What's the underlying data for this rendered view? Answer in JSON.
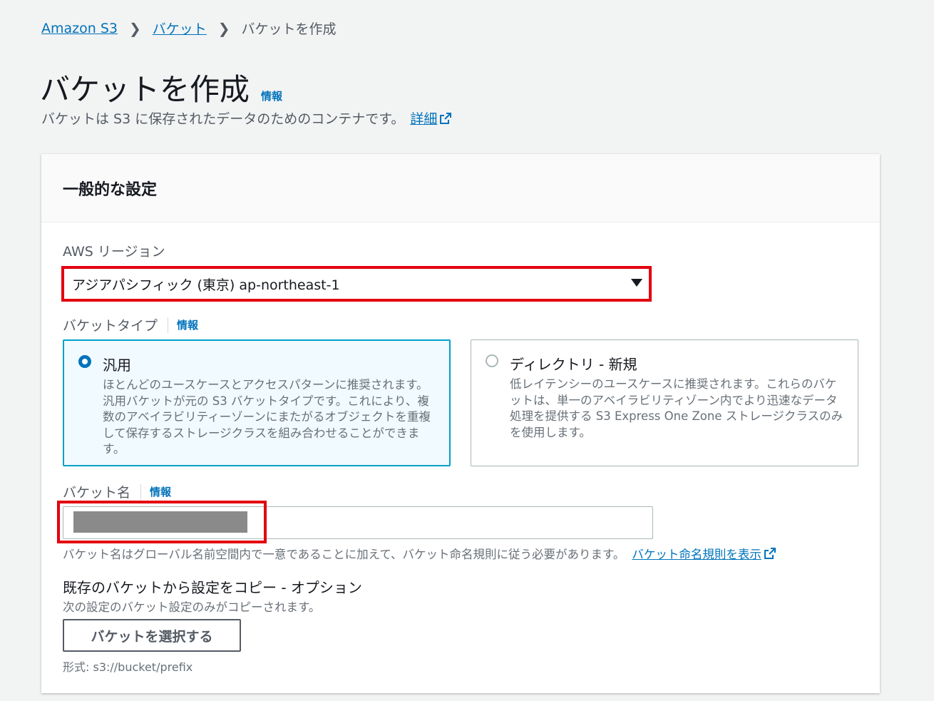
{
  "breadcrumb": {
    "items": [
      "Amazon S3",
      "バケット"
    ],
    "current": "バケットを作成"
  },
  "page": {
    "title": "バケットを作成",
    "info": "情報",
    "description": "バケットは S3 に保存されたデータのためのコンテナです。",
    "description_link": "詳細"
  },
  "general": {
    "heading": "一般的な設定",
    "region": {
      "label": "AWS リージョン",
      "value": "アジアパシフィック (東京) ap-northeast-1"
    },
    "bucket_type": {
      "label": "バケットタイプ",
      "info": "情報",
      "options": [
        {
          "title": "汎用",
          "description": "ほとんどのユースケースとアクセスパターンに推奨されます。汎用バケットが元の S3 バケットタイプです。これにより、複数のアベイラビリティーゾーンにまたがるオブジェクトを重複して保存するストレージクラスを組み合わせることができます。",
          "selected": true
        },
        {
          "title": "ディレクトリ - 新規",
          "description": "低レイテンシーのユースケースに推奨されます。これらのバケットは、単一のアベイラビリティゾーン内でより迅速なデータ処理を提供する S3 Express One Zone ストレージクラスのみを使用します。",
          "selected": false
        }
      ]
    },
    "bucket_name": {
      "label": "バケット名",
      "info": "情報",
      "help": "バケット名はグローバル名前空間内で一意であることに加えて、バケット命名規則に従う必要があります。",
      "help_link": "バケット命名規則を表示"
    },
    "copy_settings": {
      "title": "既存のバケットから設定をコピー - オプション",
      "description": "次の設定のバケット設定のみがコピーされます。",
      "button": "バケットを選択する",
      "format": "形式: s3://bucket/prefix"
    }
  },
  "colors": {
    "link": "#0073bb",
    "highlight": "#e3000f",
    "selected_border": "#00a1c9"
  }
}
